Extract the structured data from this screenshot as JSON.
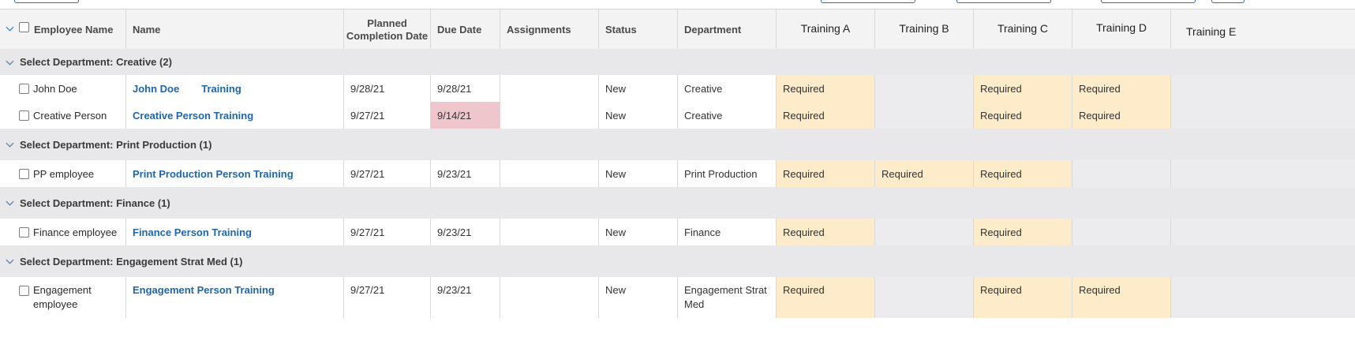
{
  "columns": {
    "employee_name": "Employee Name",
    "name": "Name",
    "planned_completion": "Planned Completion Date",
    "due_date": "Due Date",
    "assignments": "Assignments",
    "status": "Status",
    "department": "Department",
    "training_a": "Training A",
    "training_b": "Training B",
    "training_c": "Training C",
    "training_d": "Training D",
    "training_e": "Training E"
  },
  "groups": [
    {
      "label": "Select Department: Creative (2)"
    },
    {
      "label": "Select Department: Print Production (1)"
    },
    {
      "label": "Select Department: Finance (1)"
    },
    {
      "label": "Select Department: Engagement Strat Med (1)"
    }
  ],
  "rows": [
    {
      "employee": "John Doe",
      "name_a": "John Doe",
      "name_b": "Training",
      "planned": "9/28/21",
      "due": "9/28/21",
      "status": "New",
      "department": "Creative",
      "a": "Required",
      "b": "",
      "c": "Required",
      "d": "Required"
    },
    {
      "employee": "Creative Person",
      "name": "Creative Person Training",
      "planned": "9/27/21",
      "due": "9/14/21",
      "status": "New",
      "department": "Creative",
      "a": "Required",
      "b": "",
      "c": "Required",
      "d": "Required"
    },
    {
      "employee": "PP employee",
      "name": "Print Production Person Training",
      "planned": "9/27/21",
      "due": "9/23/21",
      "status": "New",
      "department": "Print Production",
      "a": "Required",
      "b": "Required",
      "c": "Required",
      "d": ""
    },
    {
      "employee": "Finance employee",
      "name": "Finance Person Training",
      "planned": "9/27/21",
      "due": "9/23/21",
      "status": "New",
      "department": "Finance",
      "a": "Required",
      "b": "",
      "c": "Required",
      "d": ""
    },
    {
      "employee_1": "Engagement",
      "employee_2": "employee",
      "name": "Engagement Person Training",
      "planned": "9/27/21",
      "due": "9/23/21",
      "status": "New",
      "department_1": "Engagement Strat",
      "department_2": "Med",
      "a": "Required",
      "b": "",
      "c": "Required",
      "d": "Required"
    }
  ],
  "colors": {
    "required": "#fdebc9",
    "overdue": "#efc6cc",
    "link": "#1f66ad",
    "group": "#e8e8ea"
  }
}
